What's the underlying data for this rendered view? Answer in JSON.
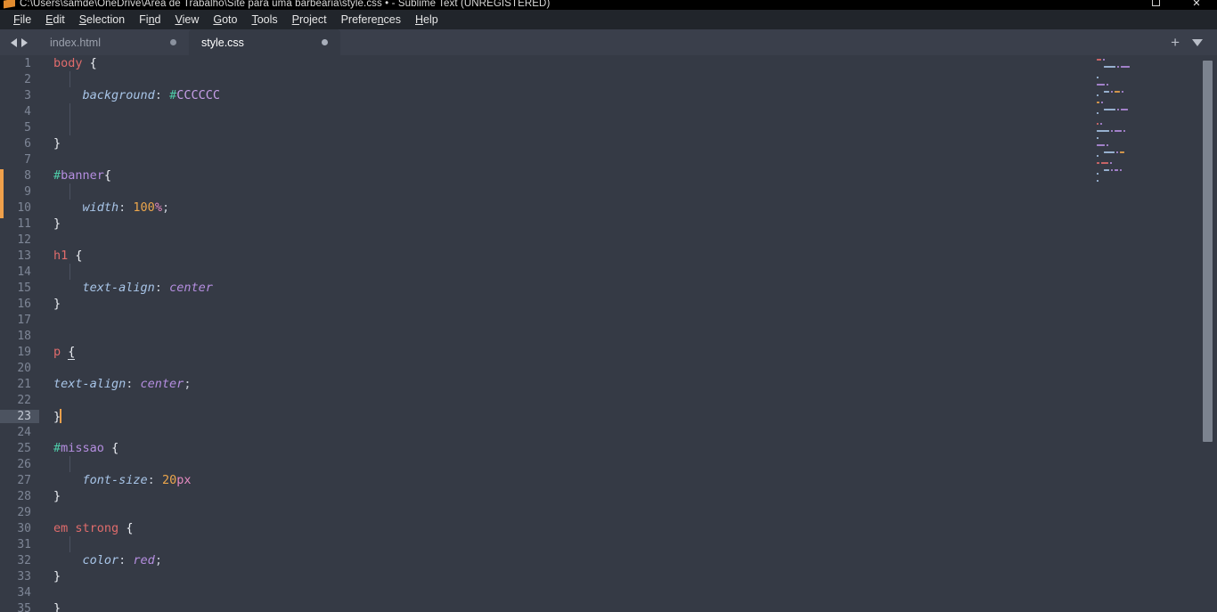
{
  "window": {
    "title": "C:\\Users\\samde\\OneDrive\\Área de Trabalho\\Site para uma barbearia\\style.css • - Sublime Text (UNREGISTERED)",
    "app_icon": "sublime-text-logo",
    "restore_label": "❐",
    "close_label": "✕"
  },
  "menubar": {
    "items": [
      {
        "label": "File",
        "mnemonic": "F"
      },
      {
        "label": "Edit",
        "mnemonic": "E"
      },
      {
        "label": "Selection",
        "mnemonic": "S"
      },
      {
        "label": "Find",
        "mnemonic": "n"
      },
      {
        "label": "View",
        "mnemonic": "V"
      },
      {
        "label": "Goto",
        "mnemonic": "G"
      },
      {
        "label": "Tools",
        "mnemonic": "T"
      },
      {
        "label": "Project",
        "mnemonic": "P"
      },
      {
        "label": "Preferences",
        "mnemonic": "n"
      },
      {
        "label": "Help",
        "mnemonic": "H"
      }
    ]
  },
  "tabbar": {
    "tabs": [
      {
        "label": "index.html",
        "active": false,
        "dirty": true
      },
      {
        "label": "style.css",
        "active": true,
        "dirty": true
      }
    ],
    "new_tab_label": "+",
    "tab_menu_label": "▼"
  },
  "editor": {
    "language": "CSS",
    "active_line": 23,
    "total_visible_lines": 35,
    "cursor_line": 23,
    "cursor_column": 2,
    "change_marker_lines": [
      8,
      9,
      10
    ],
    "lines": [
      {
        "n": 1,
        "text": "body {"
      },
      {
        "n": 2,
        "text": ""
      },
      {
        "n": 3,
        "text": "    background: #CCCCCC"
      },
      {
        "n": 4,
        "text": ""
      },
      {
        "n": 5,
        "text": ""
      },
      {
        "n": 6,
        "text": "}"
      },
      {
        "n": 7,
        "text": ""
      },
      {
        "n": 8,
        "text": "#banner{"
      },
      {
        "n": 9,
        "text": ""
      },
      {
        "n": 10,
        "text": "    width: 100%;"
      },
      {
        "n": 11,
        "text": "}"
      },
      {
        "n": 12,
        "text": ""
      },
      {
        "n": 13,
        "text": "h1 {"
      },
      {
        "n": 14,
        "text": ""
      },
      {
        "n": 15,
        "text": "    text-align: center"
      },
      {
        "n": 16,
        "text": "}"
      },
      {
        "n": 17,
        "text": ""
      },
      {
        "n": 18,
        "text": ""
      },
      {
        "n": 19,
        "text": "p {"
      },
      {
        "n": 20,
        "text": ""
      },
      {
        "n": 21,
        "text": "text-align: center;"
      },
      {
        "n": 22,
        "text": ""
      },
      {
        "n": 23,
        "text": "}"
      },
      {
        "n": 24,
        "text": ""
      },
      {
        "n": 25,
        "text": "#missao {"
      },
      {
        "n": 26,
        "text": ""
      },
      {
        "n": 27,
        "text": "    font-size: 20px"
      },
      {
        "n": 28,
        "text": "}"
      },
      {
        "n": 29,
        "text": ""
      },
      {
        "n": 30,
        "text": "em strong {"
      },
      {
        "n": 31,
        "text": ""
      },
      {
        "n": 32,
        "text": "    color: red;"
      },
      {
        "n": 33,
        "text": "}"
      },
      {
        "n": 34,
        "text": ""
      },
      {
        "n": 35,
        "text": "}"
      }
    ]
  },
  "colors": {
    "editor_background": "#353a45",
    "chrome_background": "#3a3f4b",
    "menubar_background": "#21252b",
    "titlebar_background": "#000000",
    "line_number": "#7e8696",
    "current_line_gutter": "#4c5360",
    "cursor": "#f0a04b",
    "change_marker": "#f0a04b",
    "tag_selector": "#e06c6c",
    "id_hash": "#4ec9a7",
    "id_name": "#b58ee0",
    "property": "#a8c5e8",
    "value": "#b58ee0",
    "number": "#eca64c",
    "unit": "#e58ac0",
    "brace": "#eceff4",
    "scrollbar_thumb": "#7c838f"
  }
}
